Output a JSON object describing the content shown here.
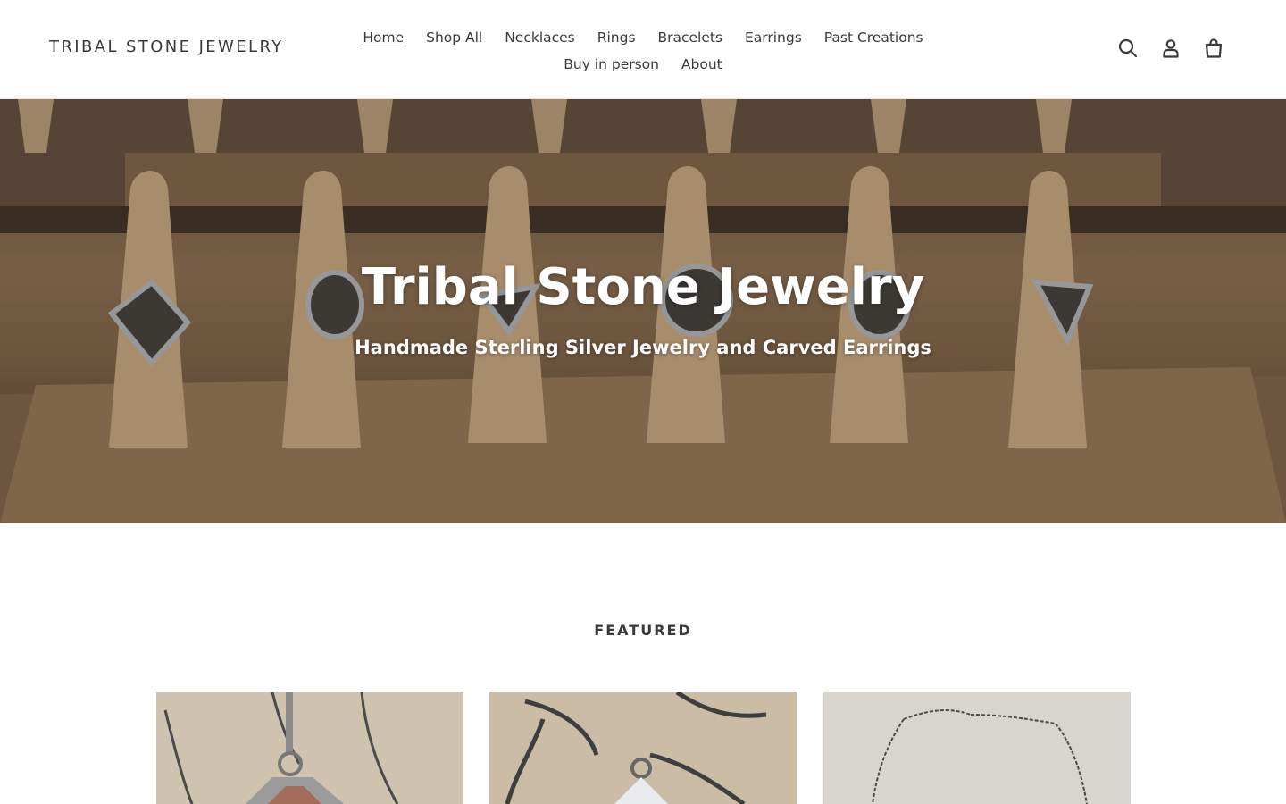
{
  "header": {
    "logo": "TRIBAL STONE JEWELRY",
    "nav": {
      "row1": [
        "Home",
        "Shop All",
        "Necklaces",
        "Rings",
        "Bracelets",
        "Earrings",
        "Past Creations"
      ],
      "row2": [
        "Buy in person",
        "About"
      ]
    },
    "icons": [
      "search-icon",
      "account-icon",
      "cart-icon"
    ]
  },
  "hero": {
    "title": "Tribal Stone Jewelry",
    "subtitle": "Handmade Sterling Silver Jewelry and Carved Earrings"
  },
  "featured": {
    "title": "FEATURED",
    "products": [
      {
        "image": "necklace-pendant-photo"
      },
      {
        "image": "necklace-pendant-photo"
      },
      {
        "image": "chain-necklace-photo"
      }
    ]
  }
}
